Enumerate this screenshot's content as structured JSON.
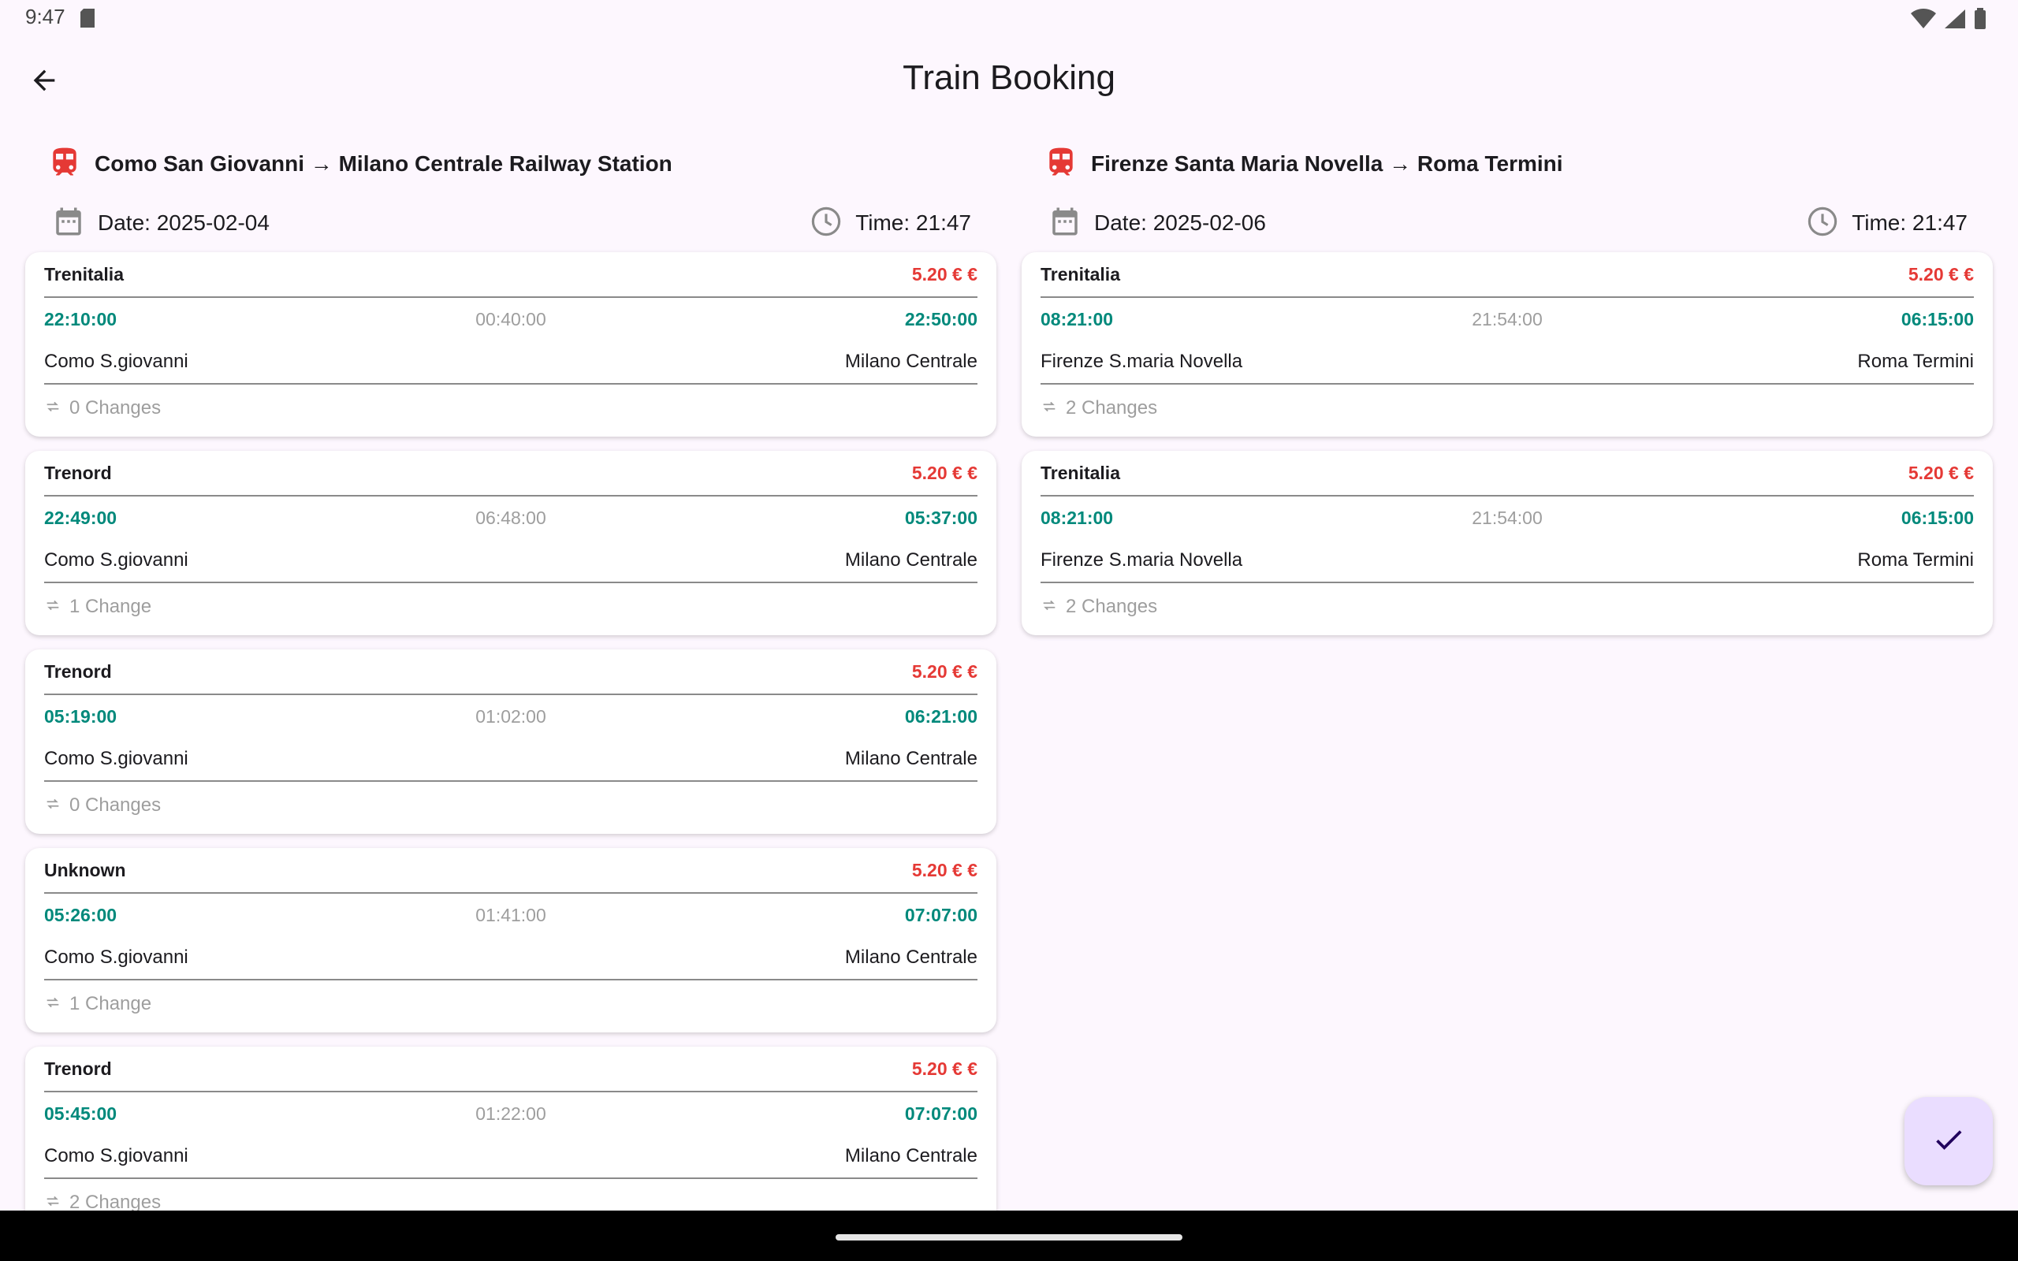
{
  "status_bar": {
    "time": "9:47",
    "icons": [
      "sd-card-icon",
      "wifi-icon",
      "signal-icon",
      "battery-icon"
    ]
  },
  "app_bar": {
    "title": "Train Booking",
    "back_icon": "arrow-back-icon"
  },
  "colors": {
    "background": "#fdf7fe",
    "price": "#e53935",
    "time": "#00897b",
    "muted": "#9e9e9e",
    "train_icon": "#e53935",
    "fab": "#eaddff"
  },
  "trips": [
    {
      "route": "Como San Giovanni → Milano Centrale Railway Station",
      "date": "Date: 2025-02-04",
      "time": "Time: 21:47",
      "options": [
        {
          "operator": "Trenitalia",
          "price": "5.20 € €",
          "departure": "22:10:00",
          "duration": "00:40:00",
          "arrival": "22:50:00",
          "from": "Como S.giovanni",
          "to": "Milano Centrale",
          "changes": "0 Changes"
        },
        {
          "operator": "Trenord",
          "price": "5.20 € €",
          "departure": "22:49:00",
          "duration": "06:48:00",
          "arrival": "05:37:00",
          "from": "Como S.giovanni",
          "to": "Milano Centrale",
          "changes": "1 Change"
        },
        {
          "operator": "Trenord",
          "price": "5.20 € €",
          "departure": "05:19:00",
          "duration": "01:02:00",
          "arrival": "06:21:00",
          "from": "Como S.giovanni",
          "to": "Milano Centrale",
          "changes": "0 Changes"
        },
        {
          "operator": "Unknown",
          "price": "5.20 € €",
          "departure": "05:26:00",
          "duration": "01:41:00",
          "arrival": "07:07:00",
          "from": "Como S.giovanni",
          "to": "Milano Centrale",
          "changes": "1 Change"
        },
        {
          "operator": "Trenord",
          "price": "5.20 € €",
          "departure": "05:45:00",
          "duration": "01:22:00",
          "arrival": "07:07:00",
          "from": "Como S.giovanni",
          "to": "Milano Centrale",
          "changes": "2 Changes"
        }
      ]
    },
    {
      "route": "Firenze Santa Maria Novella → Roma Termini",
      "date": "Date: 2025-02-06",
      "time": "Time: 21:47",
      "options": [
        {
          "operator": "Trenitalia",
          "price": "5.20 € €",
          "departure": "08:21:00",
          "duration": "21:54:00",
          "arrival": "06:15:00",
          "from": "Firenze S.maria Novella",
          "to": "Roma Termini",
          "changes": "2 Changes"
        },
        {
          "operator": "Trenitalia",
          "price": "5.20 € €",
          "departure": "08:21:00",
          "duration": "21:54:00",
          "arrival": "06:15:00",
          "from": "Firenze S.maria Novella",
          "to": "Roma Termini",
          "changes": "2 Changes"
        }
      ]
    }
  ],
  "fab": {
    "icon": "check-icon"
  }
}
